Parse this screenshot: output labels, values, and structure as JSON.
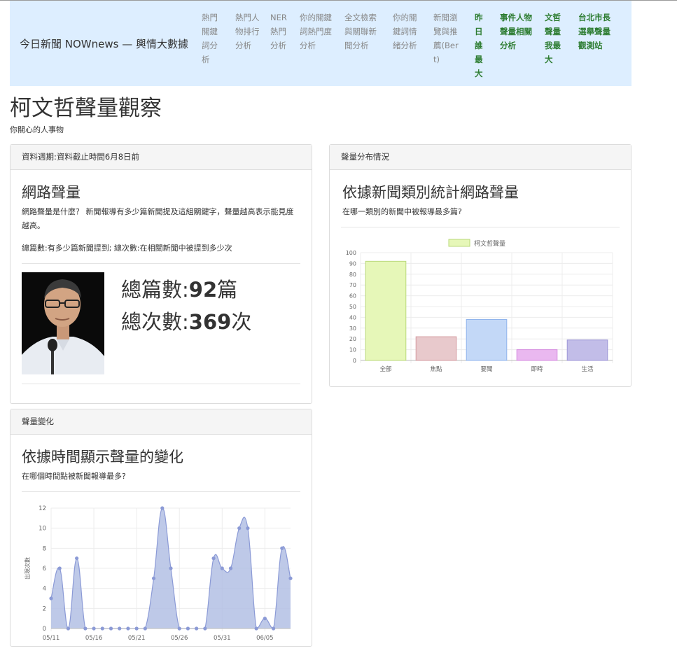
{
  "nav": {
    "brand": "今日新聞 NOWnews — 輿情大數據",
    "items": [
      {
        "label": "熱門關鍵詞分析",
        "color": "#888888"
      },
      {
        "label": "熱門人物排行分析",
        "color": "#888888"
      },
      {
        "label": "NER熱門分析",
        "color": "#888888"
      },
      {
        "label": "你的關鍵詞熱門度分析",
        "color": "#888888"
      },
      {
        "label": "全文檢索與關聯新聞分析",
        "color": "#888888"
      },
      {
        "label": "你的關鍵詞情緒分析",
        "color": "#888888"
      },
      {
        "label": "新聞瀏覽與推薦(Bert)",
        "color": "#888888"
      },
      {
        "label": "昨日誰最大",
        "color": "#2e7d32"
      },
      {
        "label": "事件人物聲量相關分析",
        "color": "#2e7d32"
      },
      {
        "label": "文哲聲量我最大",
        "color": "#2e7d32"
      },
      {
        "label": "台北市長選舉聲量觀測站",
        "color": "#2e7d32"
      }
    ]
  },
  "page": {
    "title": "柯文哲聲量觀察",
    "subtitle": "你關心的人事物"
  },
  "panel_volume": {
    "heading": "資料週期:資料截止時間6月8日前",
    "title": "網路聲量",
    "desc": "網路聲量是什麼？ 新聞報導有多少篇新聞提及這組關鍵字，聲量越高表示能見度越高。",
    "note": "總篇數:有多少篇新聞提到; 總次數:在相關新聞中被提到多少次",
    "articles_label": "總篇數:",
    "articles_value": "92",
    "articles_unit": "篇",
    "mentions_label": "總次數:",
    "mentions_value": "369",
    "mentions_unit": "次"
  },
  "panel_distribution": {
    "heading": "聲量分布情況",
    "title": "依據新聞類別統計網路聲量",
    "desc": "在哪一類別的新聞中被報導最多篇?"
  },
  "panel_trend": {
    "heading": "聲量變化",
    "title": "依據時間顯示聲量的變化",
    "desc": "在哪個時間點被新聞報導最多?"
  },
  "chart_data": [
    {
      "type": "bar",
      "legend": "柯文哲聲量",
      "legend_position": "top",
      "categories": [
        "全部",
        "焦點",
        "要聞",
        "即時",
        "生活"
      ],
      "values": [
        92,
        22,
        38,
        10,
        19
      ],
      "colors": [
        "#e6f7b8",
        "#e8c9cc",
        "#c3d8f7",
        "#eab8f0",
        "#c2bde8"
      ],
      "border_colors": [
        "#b9d97a",
        "#d49aa0",
        "#8fb4ec",
        "#d58ae0",
        "#9d96d8"
      ],
      "ylim": [
        0,
        100
      ],
      "yticks": [
        0,
        10,
        20,
        30,
        40,
        50,
        60,
        70,
        80,
        90,
        100
      ],
      "grid": true
    },
    {
      "type": "area",
      "ylabel": "出現次數",
      "ylim": [
        0,
        12
      ],
      "yticks": [
        0,
        2,
        4,
        6,
        8,
        10,
        12
      ],
      "x_tick_labels": [
        "05/11",
        "05/16",
        "05/21",
        "05/26",
        "05/31",
        "06/05"
      ],
      "x_tick_index": [
        0,
        5,
        10,
        15,
        20,
        25
      ],
      "x": [
        "05/11",
        "05/12",
        "05/13",
        "05/14",
        "05/15",
        "05/16",
        "05/17",
        "05/18",
        "05/19",
        "05/20",
        "05/21",
        "05/22",
        "05/23",
        "05/24",
        "05/25",
        "05/26",
        "05/27",
        "05/28",
        "05/29",
        "05/30",
        "05/31",
        "06/01",
        "06/02",
        "06/03",
        "06/04",
        "06/05",
        "06/06",
        "06/07",
        "06/08"
      ],
      "values": [
        3,
        6,
        0,
        7,
        0,
        0,
        0,
        0,
        0,
        0,
        0,
        0,
        5,
        12,
        6,
        0,
        0,
        0,
        0,
        7,
        6,
        6,
        10,
        10,
        0,
        1,
        0,
        8,
        5
      ],
      "fill": "#b3bfe4",
      "line": "#8b9ad6",
      "grid": true
    }
  ]
}
